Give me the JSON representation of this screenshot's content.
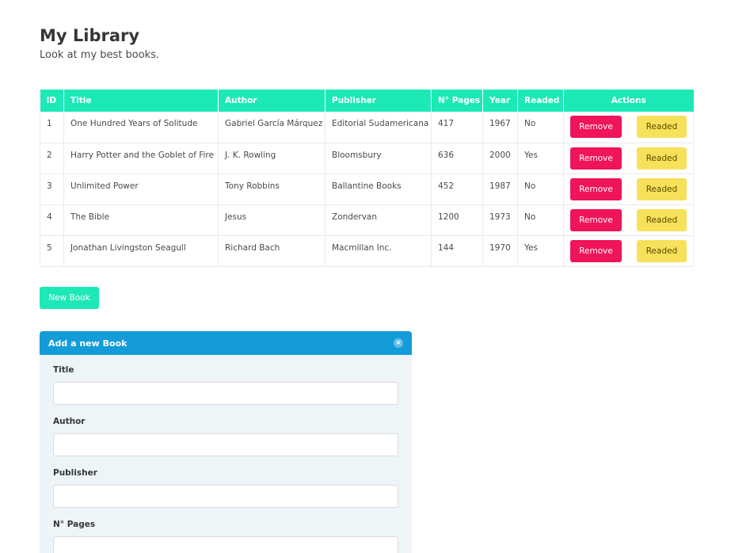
{
  "header": {
    "title": "My Library",
    "subtitle": "Look at my best books."
  },
  "table": {
    "columns": [
      "ID",
      "Title",
      "Author",
      "Publisher",
      "N° Pages",
      "Year",
      "Readed",
      "Actions"
    ],
    "rows": [
      {
        "id": "1",
        "title": "One Hundred Years of Solitude",
        "author": "Gabriel García Márquez",
        "publisher": "Editorial Sudamericana",
        "pages": "417",
        "year": "1967",
        "readed": "No"
      },
      {
        "id": "2",
        "title": "Harry Potter and the Goblet of Fire",
        "author": "J. K. Rowling",
        "publisher": "Bloomsbury",
        "pages": "636",
        "year": "2000",
        "readed": "Yes"
      },
      {
        "id": "3",
        "title": "Unlimited Power",
        "author": "Tony Robbins",
        "publisher": "Ballantine Books",
        "pages": "452",
        "year": "1987",
        "readed": "No"
      },
      {
        "id": "4",
        "title": "The Bible",
        "author": "Jesus",
        "publisher": "Zondervan",
        "pages": "1200",
        "year": "1973",
        "readed": "No"
      },
      {
        "id": "5",
        "title": "Jonathan Livingston Seagull",
        "author": "Richard Bach",
        "publisher": "Macmillan Inc.",
        "pages": "144",
        "year": "1970",
        "readed": "Yes"
      }
    ],
    "remove_label": "Remove",
    "readed_label": "Readed"
  },
  "new_book_label": "New Book",
  "form": {
    "title": "Add a new Book",
    "close_icon": "×",
    "fields": [
      {
        "label": "Title",
        "value": ""
      },
      {
        "label": "Author",
        "value": ""
      },
      {
        "label": "Publisher",
        "value": ""
      },
      {
        "label": "N° Pages",
        "value": ""
      }
    ]
  },
  "colors": {
    "accent": "#1de9b6",
    "remove": "#f0145a",
    "readed": "#f7e15a",
    "panel_header": "#149cd8"
  }
}
